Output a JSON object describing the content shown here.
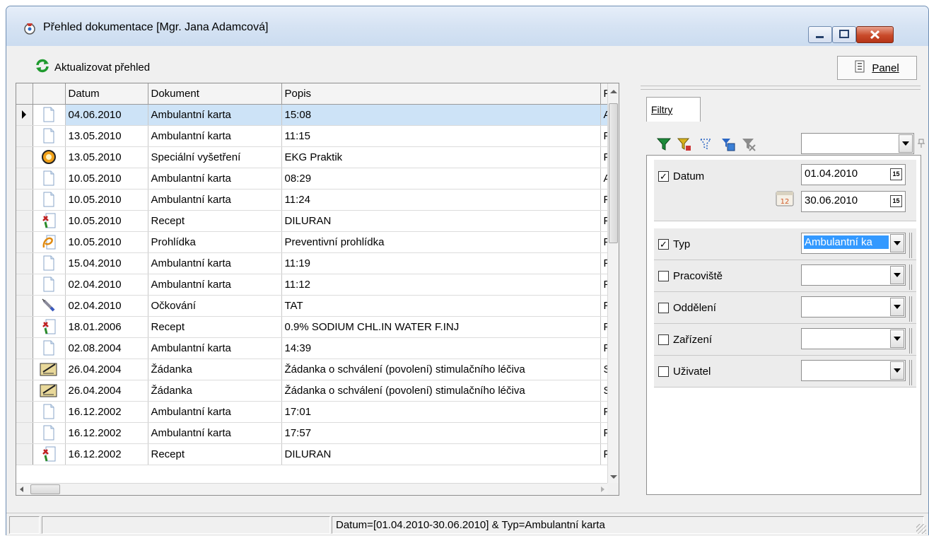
{
  "window": {
    "title": "Přehled dokumentace [Mgr. Jana Adamcová]"
  },
  "toolbar": {
    "refresh_label": "Aktualizovat přehled",
    "panel_label": "Panel"
  },
  "grid": {
    "columns": [
      "Datum",
      "Dokument",
      "Popis",
      "Pl"
    ],
    "rows": [
      {
        "icon": "document-icon",
        "datum": "04.06.2010",
        "dokument": "Ambulantní karta",
        "popis": "15:08",
        "extra": "Al",
        "selected": true
      },
      {
        "icon": "document-icon",
        "datum": "13.05.2010",
        "dokument": "Ambulantní karta",
        "popis": "11:15",
        "extra": "Pl"
      },
      {
        "icon": "special-exam-icon",
        "datum": "13.05.2010",
        "dokument": "Speciální vyšetření",
        "popis": "EKG Praktik",
        "extra": "Pl"
      },
      {
        "icon": "document-icon",
        "datum": "10.05.2010",
        "dokument": "Ambulantní karta",
        "popis": "08:29",
        "extra": "Al"
      },
      {
        "icon": "document-icon",
        "datum": "10.05.2010",
        "dokument": "Ambulantní karta",
        "popis": "11:24",
        "extra": "Pl"
      },
      {
        "icon": "prescription-icon",
        "datum": "10.05.2010",
        "dokument": "Recept",
        "popis": "DILURAN",
        "extra": "Pl"
      },
      {
        "icon": "checkup-icon",
        "datum": "10.05.2010",
        "dokument": "Prohlídka",
        "popis": "Preventivní prohlídka",
        "extra": "Pl"
      },
      {
        "icon": "document-icon",
        "datum": "15.04.2010",
        "dokument": "Ambulantní karta",
        "popis": "11:19",
        "extra": "Pl"
      },
      {
        "icon": "document-icon",
        "datum": "02.04.2010",
        "dokument": "Ambulantní karta",
        "popis": "11:12",
        "extra": "Pl"
      },
      {
        "icon": "syringe-icon",
        "datum": "02.04.2010",
        "dokument": "Očkování",
        "popis": "TAT",
        "extra": "Pl"
      },
      {
        "icon": "prescription-icon",
        "datum": "18.01.2006",
        "dokument": "Recept",
        "popis": "0.9% SODIUM CHL.IN WATER F.INJ",
        "extra": "Pl"
      },
      {
        "icon": "document-icon",
        "datum": "02.08.2004",
        "dokument": "Ambulantní karta",
        "popis": "14:39",
        "extra": "Pl"
      },
      {
        "icon": "request-icon",
        "datum": "26.04.2004",
        "dokument": "Žádanka",
        "popis": "Žádanka o schválení (povolení) stimulačního léčiva",
        "extra": "S"
      },
      {
        "icon": "request-icon",
        "datum": "26.04.2004",
        "dokument": "Žádanka",
        "popis": "Žádanka o schválení (povolení) stimulačního léčiva",
        "extra": "S"
      },
      {
        "icon": "document-icon",
        "datum": "16.12.2002",
        "dokument": "Ambulantní karta",
        "popis": "17:01",
        "extra": "Pl"
      },
      {
        "icon": "document-icon",
        "datum": "16.12.2002",
        "dokument": "Ambulantní karta",
        "popis": "17:57",
        "extra": "Pl"
      },
      {
        "icon": "prescription-icon",
        "datum": "16.12.2002",
        "dokument": "Recept",
        "popis": "DILURAN",
        "extra": "Pl"
      }
    ]
  },
  "panel": {
    "tab_label": "Filtry",
    "filters": [
      {
        "key": "datum",
        "label": "Datum",
        "checked": true,
        "from": "01.04.2010",
        "to": "30.06.2010"
      },
      {
        "key": "typ",
        "label": "Typ",
        "checked": true,
        "value": "Ambulantní ka"
      },
      {
        "key": "pracoviste",
        "label": "Pracoviště",
        "checked": false,
        "value": ""
      },
      {
        "key": "oddeleni",
        "label": "Oddělení",
        "checked": false,
        "value": ""
      },
      {
        "key": "zarizeni",
        "label": "Zařízení",
        "checked": false,
        "value": ""
      },
      {
        "key": "uzivatel",
        "label": "Uživatel",
        "checked": false,
        "value": ""
      }
    ],
    "calendar_badge": "15",
    "calendar_icon_text": "12"
  },
  "status": {
    "filter_text": "Datum=[01.04.2010-30.06.2010] & Typ=Ambulantní karta"
  },
  "colors": {
    "selection": "#cde3f7",
    "typ_highlight": "#3399ff",
    "close_button": "#c94a2a"
  }
}
